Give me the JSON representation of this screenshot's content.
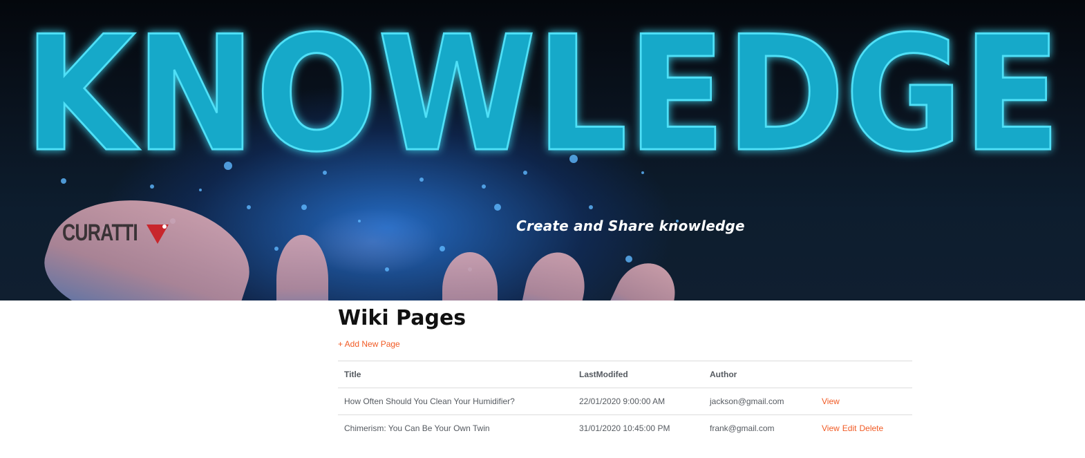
{
  "hero": {
    "word": "KNOWLEDGE",
    "logo_text": "CURATTI",
    "tagline": "Create and Share knowledge"
  },
  "main": {
    "title": "Wiki Pages",
    "add_link": "+ Add New Page"
  },
  "table": {
    "headers": {
      "title": "Title",
      "modified": "LastModifed",
      "author": "Author",
      "actions": ""
    },
    "rows": [
      {
        "title": "How Often Should You Clean Your Humidifier?",
        "modified": "22/01/2020 9:00:00 AM",
        "author": "jackson@gmail.com",
        "actions": [
          "View"
        ]
      },
      {
        "title": "Chimerism: You Can Be Your Own Twin",
        "modified": "31/01/2020 10:45:00 PM",
        "author": "frank@gmail.com",
        "actions": [
          "View",
          "Edit",
          "Delete"
        ]
      }
    ]
  },
  "colors": {
    "accent": "#f15a24",
    "hero_glow": "#1ec8e8",
    "logo_red": "#c8262c"
  }
}
